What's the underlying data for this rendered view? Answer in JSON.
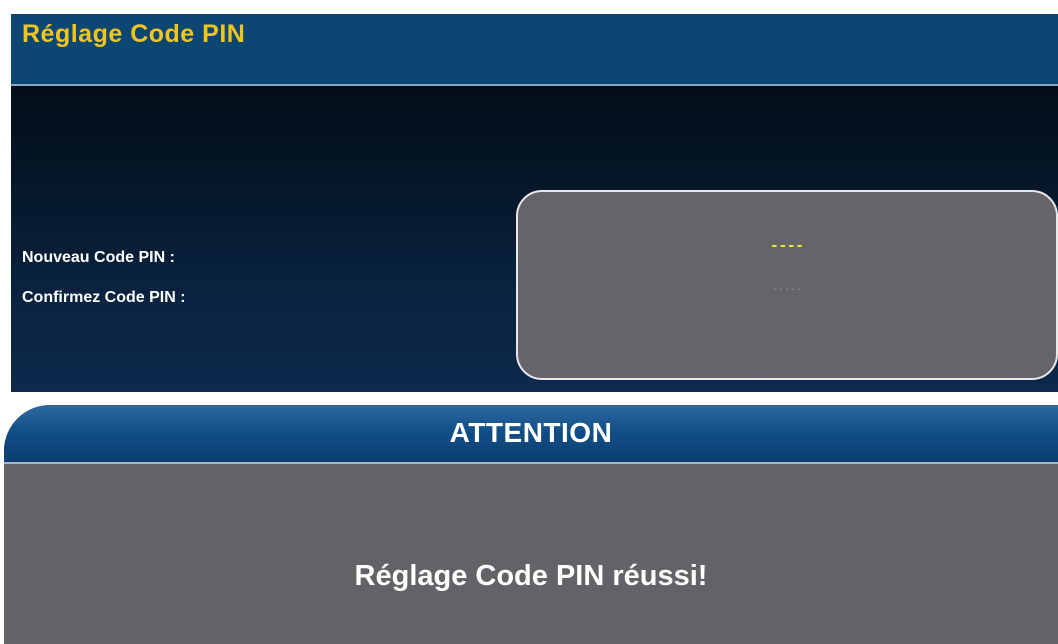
{
  "pin_settings": {
    "title": "Réglage Code PIN",
    "new_pin_label": "Nouveau Code PIN :",
    "confirm_pin_label": "Confirmez Code PIN :",
    "new_pin_value": "----",
    "confirm_pin_value": "-----"
  },
  "dialog": {
    "title": "ATTENTION",
    "message": "Réglage Code PIN réussi!"
  },
  "colors": {
    "title_yellow": "#f2c51d",
    "header_blue": "#0c4774",
    "box_gray": "#666468",
    "active_value_yellow": "#f2e531"
  }
}
